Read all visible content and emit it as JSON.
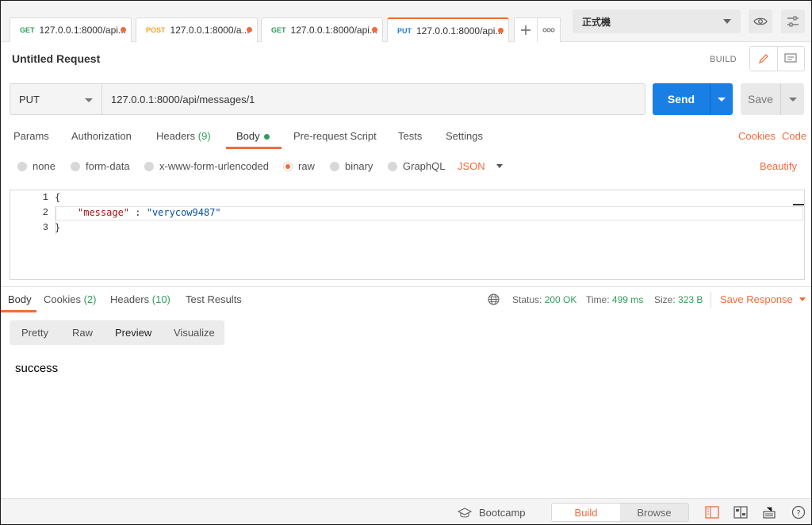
{
  "tabs": [
    {
      "method": "GET",
      "url": "127.0.0.1:8000/api..."
    },
    {
      "method": "POST",
      "url": "127.0.0.1:8000/a..."
    },
    {
      "method": "GET",
      "url": "127.0.0.1:8000/api..."
    },
    {
      "method": "PUT",
      "url": "127.0.0.1:8000/api..."
    }
  ],
  "environment": {
    "selected": "正式機"
  },
  "request": {
    "title": "Untitled Request",
    "mode_label": "BUILD",
    "method": "PUT",
    "url": "127.0.0.1:8000/api/messages/1",
    "send_label": "Send",
    "save_label": "Save"
  },
  "request_tabs": {
    "params": "Params",
    "authorization": "Authorization",
    "headers": "Headers",
    "headers_count": "(9)",
    "body": "Body",
    "prerequest": "Pre-request Script",
    "tests": "Tests",
    "settings": "Settings",
    "cookies": "Cookies",
    "code": "Code"
  },
  "body_types": {
    "none": "none",
    "form_data": "form-data",
    "urlencoded": "x-www-form-urlencoded",
    "raw": "raw",
    "binary": "binary",
    "graphql": "GraphQL",
    "format": "JSON",
    "beautify": "Beautify",
    "selected": "raw"
  },
  "editor": {
    "line_numbers": [
      "1",
      "2",
      "3"
    ],
    "line1": "{",
    "key": "\"message\"",
    "sep": " : ",
    "value": "\"verycow9487\"",
    "line3": "}"
  },
  "response": {
    "tabs": {
      "body": "Body",
      "cookies": "Cookies",
      "cookies_count": "(2)",
      "headers": "Headers",
      "headers_count": "(10)",
      "tests": "Test Results"
    },
    "status_label": "Status:",
    "status_value": "200 OK",
    "time_label": "Time:",
    "time_value": "499 ms",
    "size_label": "Size:",
    "size_value": "323 B",
    "save_response": "Save Response",
    "views": {
      "pretty": "Pretty",
      "raw": "Raw",
      "preview": "Preview",
      "visualize": "Visualize",
      "selected": "Preview"
    },
    "preview_text": "success"
  },
  "statusbar": {
    "bootcamp": "Bootcamp",
    "build": "Build",
    "browse": "Browse"
  },
  "colors": {
    "accent": "#f26b3a",
    "send": "#1a7fe5",
    "success": "#2f9d5a",
    "get": "#2f9d5a",
    "post": "#f4a623",
    "put": "#1d7fd6"
  },
  "icons": [
    "plus-icon",
    "more-icon",
    "eye-icon",
    "sliders-icon",
    "pencil-icon",
    "comment-icon",
    "globe-icon",
    "graduation-cap-icon",
    "two-pane-icon",
    "split-icon",
    "keyboard-icon",
    "help-icon"
  ]
}
